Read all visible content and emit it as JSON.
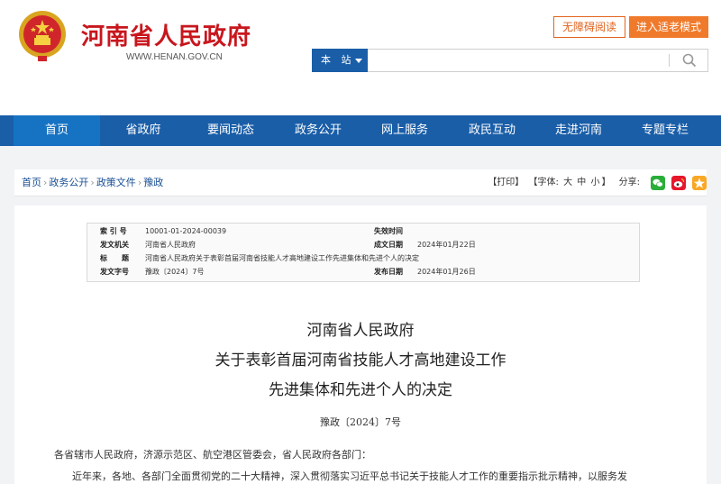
{
  "header": {
    "site_title": "河南省人民政府",
    "site_domain": "WWW.HENAN.GOV.CN",
    "accessibility_label": "无障碍阅读",
    "elder_mode_label": "进入适老模式",
    "search_scope": "本 站",
    "search_value": ""
  },
  "nav": {
    "items": [
      "首页",
      "省政府",
      "要闻动态",
      "政务公开",
      "网上服务",
      "政民互动",
      "走进河南",
      "专题专栏"
    ],
    "active_index": 0
  },
  "breadcrumb": {
    "items": [
      "首页",
      "政务公开",
      "政策文件",
      "豫政"
    ],
    "separator": "›"
  },
  "tools": {
    "print": "【打印】",
    "font_prefix": "【字体:",
    "font_large": "大",
    "font_medium": "中",
    "font_small": "小",
    "font_suffix": "】",
    "share_label": "分享:"
  },
  "meta": {
    "index_label": "索 引 号",
    "index_value": "10001-01-2024-00039",
    "effective_label": "失效时间",
    "effective_value": "",
    "issuer_label": "发文机关",
    "issuer_value": "河南省人民政府",
    "written_label": "成文日期",
    "written_value": "2024年01月22日",
    "title_label": "标　　题",
    "title_value": "河南省人民政府关于表彰首届河南省技能人才高地建设工作先进集体和先进个人的决定",
    "doc_no_label": "发文字号",
    "doc_no_value": "豫政〔2024〕7号",
    "publish_label": "发布日期",
    "publish_value": "2024年01月26日"
  },
  "document": {
    "title_line1": "河南省人民政府",
    "title_line2": "关于表彰首届河南省技能人才高地建设工作",
    "title_line3": "先进集体和先进个人的决定",
    "doc_number": "豫政〔2024〕7号",
    "addressee": "各省辖市人民政府，济源示范区、航空港区管委会，省人民政府各部门：",
    "first_paragraph": "近年来，各地、各部门全面贯彻党的二十大精神，深入贯彻落实习近平总书记关于技能人才工作的重要指示批示精神，以服务发"
  },
  "colors": {
    "brand_red": "#c8161d",
    "nav_blue": "#1a5ea8",
    "accent_orange": "#f07a2b"
  }
}
